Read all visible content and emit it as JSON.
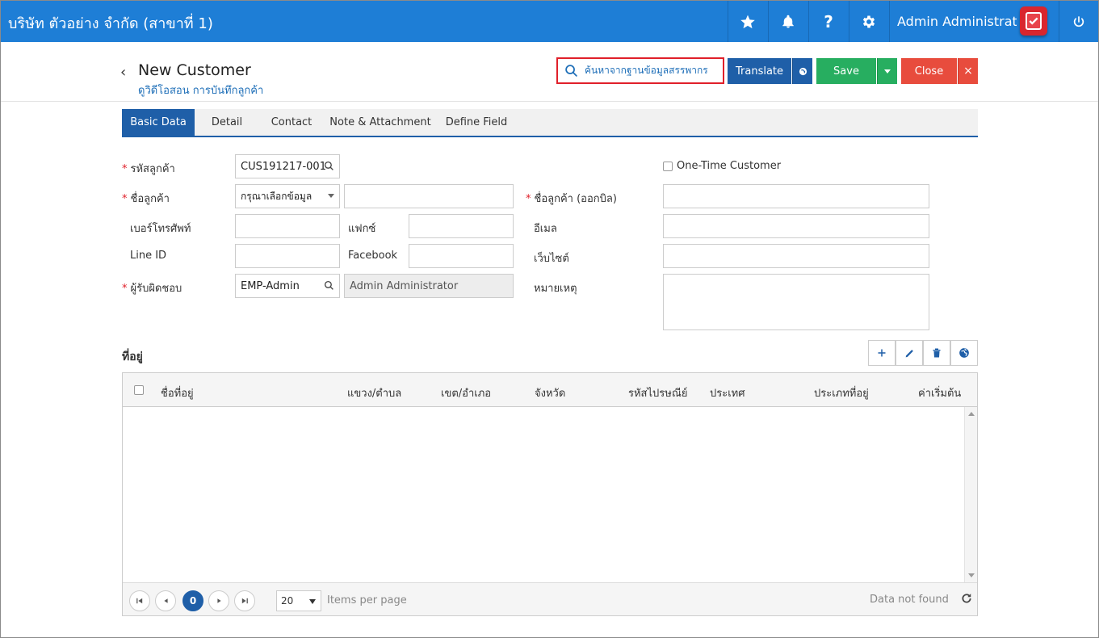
{
  "topbar": {
    "company": "บริษัท ตัวอย่าง จำกัด (สาขาที่ 1)",
    "user": "Admin Administrator",
    "icons": [
      "star-icon",
      "bell-icon",
      "help-icon",
      "gear-icon",
      "power-icon"
    ],
    "help_glyph": "?"
  },
  "header": {
    "back_glyph": "‹",
    "title": "New Customer",
    "subtitle": "ดูวิดีโอสอน การบันทึกลูกค้า",
    "search_label": "ค้นหาจากฐานข้อมูลสรรพากร",
    "translate_label": "Translate",
    "save_label": "Save",
    "close_label": "Close",
    "close_x": "×"
  },
  "tabs": [
    "Basic Data",
    "Detail",
    "Contact",
    "Note & Attachment",
    "Define Field"
  ],
  "form": {
    "customer_code_label": "รหัสลูกค้า",
    "customer_code_value": "CUS191217-001",
    "customer_name_label": "ชื่อลูกค้า",
    "prefix_select": "กรุณาเลือกข้อมูล",
    "bill_name_label": "ชื่อลูกค้า (ออกบิล)",
    "one_time_label": "One-Time Customer",
    "phone_label": "เบอร์โทรศัพท์",
    "fax_label": "แฟกซ์",
    "email_label": "อีเมล",
    "line_label": "Line ID",
    "facebook_label": "Facebook",
    "website_label": "เว็บไซต์",
    "owner_label": "ผู้รับผิดชอบ",
    "owner_code": "EMP-Admin",
    "owner_name": "Admin Administrator",
    "note_label": "หมายเหตุ",
    "required_mark": "*"
  },
  "address": {
    "title": "ที่อยู่",
    "columns": [
      "ชื่อที่อยู่",
      "แขวง/ตำบล",
      "เขต/อำเภอ",
      "จังหวัด",
      "รหัสไปรษณีย์",
      "ประเทศ",
      "ประเภทที่อยู่",
      "ค่าเริ่มต้น"
    ],
    "current_page": "0",
    "page_size": "20",
    "items_per_page": "Items per page",
    "empty_text": "Data not found"
  },
  "colors": {
    "topbar": "#1e7ed6",
    "primary": "#1f5fa8",
    "save": "#27ae60",
    "close": "#e84c3d",
    "highlight": "#e0202a"
  }
}
